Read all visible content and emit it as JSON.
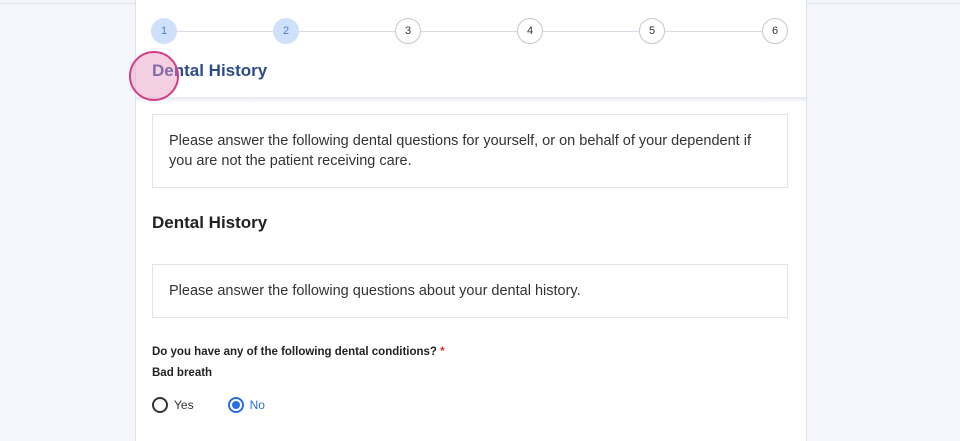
{
  "stepper": {
    "steps": [
      {
        "label": "1",
        "status": "complete"
      },
      {
        "label": "2",
        "status": "complete"
      },
      {
        "label": "3",
        "status": "upcoming"
      },
      {
        "label": "4",
        "status": "upcoming"
      },
      {
        "label": "5",
        "status": "upcoming"
      },
      {
        "label": "6",
        "status": "upcoming"
      }
    ]
  },
  "header": {
    "title": "Dental History"
  },
  "intro": {
    "text": "Please answer the following dental questions for yourself, or on behalf of your dependent if you are not the patient receiving care."
  },
  "section": {
    "title": "Dental History",
    "info": "Please answer the following questions about your dental history."
  },
  "question": {
    "label": "Do you have any of the following dental conditions?",
    "required_mark": "*",
    "item": "Bad breath",
    "options": [
      {
        "label": "Yes",
        "checked": false
      },
      {
        "label": "No",
        "checked": true
      }
    ]
  },
  "colors": {
    "accent": "#2a6de0",
    "header_title": "#2c4c8c",
    "step_complete_bg": "#cfe0fb",
    "required": "#d92d2d"
  }
}
